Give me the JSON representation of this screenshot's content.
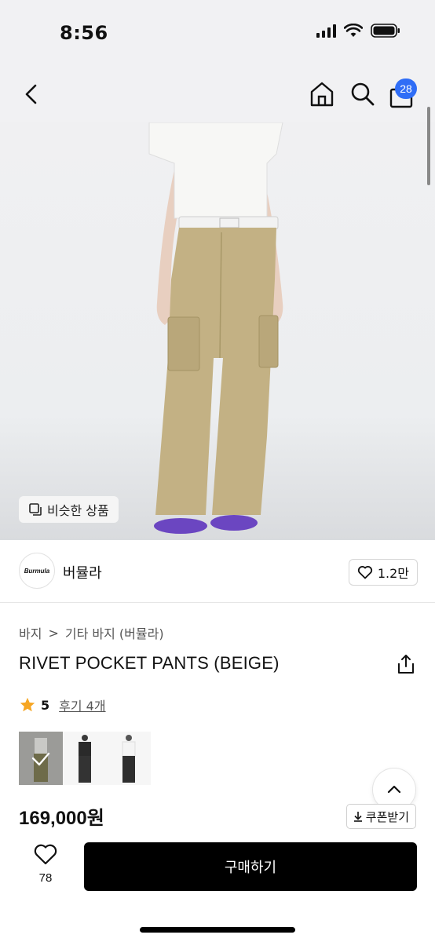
{
  "status": {
    "time": "8:56"
  },
  "nav": {
    "cart_count": "28"
  },
  "hero": {
    "similar_label": "비슷한 상품"
  },
  "brand": {
    "logo_text": "Burmula",
    "name": "버뮬라",
    "likes": "1.2만"
  },
  "breadcrumb": {
    "level1": "바지",
    "separator": ">",
    "level2": "기타 바지 (버뮬라)"
  },
  "product": {
    "title": "RIVET POCKET PANTS (BEIGE)",
    "rating_score": "5",
    "review_link": "후기 4개",
    "price": "169,000원",
    "coupon_label": "쿠폰받기"
  },
  "thumbnails": [
    {
      "name": "beige",
      "selected": true
    },
    {
      "name": "black-1",
      "selected": false
    },
    {
      "name": "black-2",
      "selected": false
    }
  ],
  "bottom": {
    "fav_count": "78",
    "buy_label": "구매하기"
  },
  "colors": {
    "accent_blue": "#2f6df6",
    "star": "#f6a623",
    "buy_button": "#000000"
  }
}
